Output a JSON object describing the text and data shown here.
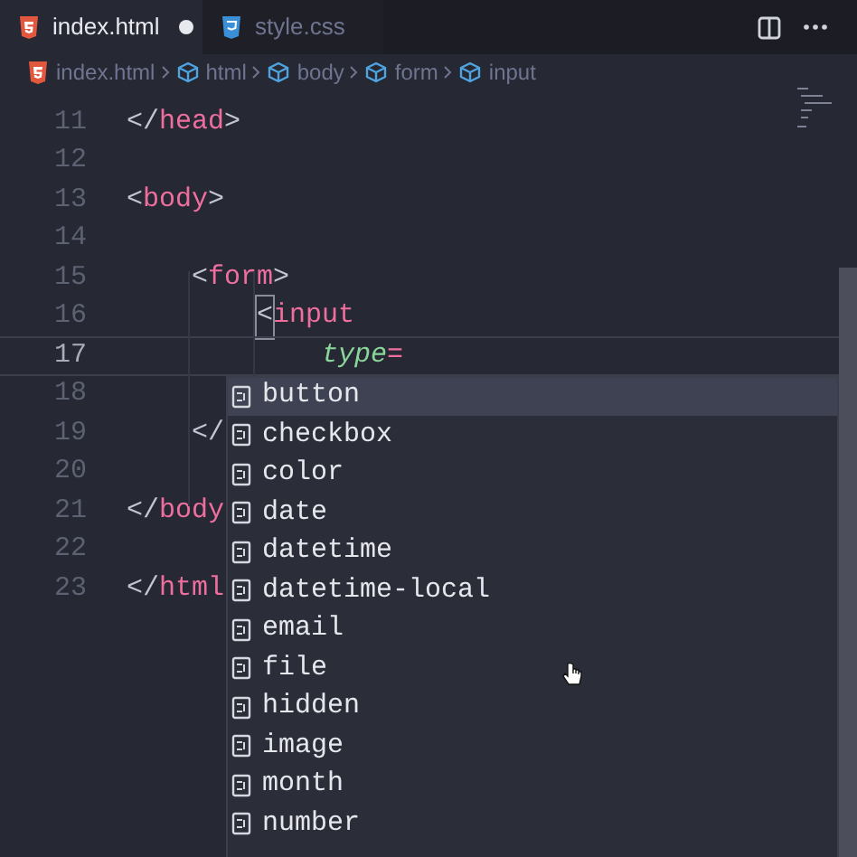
{
  "tabs": [
    {
      "label": "index.html",
      "kind": "html",
      "selected": true,
      "modified": true
    },
    {
      "label": "style.css",
      "kind": "css",
      "selected": false,
      "modified": false
    }
  ],
  "breadcrumb": [
    {
      "label": "index.html",
      "kind": "file"
    },
    {
      "label": "html",
      "kind": "element"
    },
    {
      "label": "body",
      "kind": "element"
    },
    {
      "label": "form",
      "kind": "element"
    },
    {
      "label": "input",
      "kind": "element"
    }
  ],
  "lines": [
    {
      "number": "11",
      "current": false,
      "tokens": [
        {
          "kind": "bracket",
          "text": "</"
        },
        {
          "kind": "tag",
          "text": "head"
        },
        {
          "kind": "bracket",
          "text": ">"
        }
      ]
    },
    {
      "number": "12",
      "current": false
    },
    {
      "number": "13",
      "current": false,
      "tokens": [
        {
          "kind": "bracket",
          "text": "<"
        },
        {
          "kind": "tag",
          "text": "body"
        },
        {
          "kind": "bracket",
          "text": ">"
        }
      ],
      "children": [
        {
          "number": "14",
          "current": false
        },
        {
          "number": "15",
          "current": false,
          "tokens": [
            {
              "kind": "bracket",
              "text": "<"
            },
            {
              "kind": "tag",
              "text": "form"
            },
            {
              "kind": "bracket",
              "text": ">"
            }
          ],
          "children": [
            {
              "number": "16",
              "current": false,
              "tokens": [
                {
                  "kind": "matched",
                  "text": "<"
                },
                {
                  "kind": "tag",
                  "text": "input"
                }
              ],
              "children": [
                {
                  "number": "17",
                  "current": true,
                  "tokens": [
                    {
                      "kind": "attr",
                      "text": "type"
                    },
                    {
                      "kind": "tag",
                      "text": "="
                    }
                  ]
                }
              ]
            },
            {
              "number": "18",
              "current": false
            }
          ]
        },
        {
          "number": "19",
          "current": false,
          "tokens": [
            {
              "kind": "bracket",
              "text": "</"
            }
          ]
        },
        {
          "number": "20",
          "current": false
        }
      ]
    },
    {
      "number": "21",
      "current": false,
      "tokens": [
        {
          "kind": "bracket",
          "text": "</"
        },
        {
          "kind": "tag",
          "text": "body"
        }
      ]
    },
    {
      "number": "22",
      "current": false
    },
    {
      "number": "23",
      "current": false,
      "tokens": [
        {
          "kind": "bracket",
          "text": "</"
        },
        {
          "kind": "tag",
          "text": "html"
        }
      ]
    }
  ],
  "suggestions": [
    {
      "label": "button",
      "selected": true
    },
    {
      "label": "checkbox",
      "selected": false
    },
    {
      "label": "color",
      "selected": false
    },
    {
      "label": "date",
      "selected": false
    },
    {
      "label": "datetime",
      "selected": false
    },
    {
      "label": "datetime-local",
      "selected": false
    },
    {
      "label": "email",
      "selected": false
    },
    {
      "label": "file",
      "selected": false
    },
    {
      "label": "hidden",
      "selected": false
    },
    {
      "label": "image",
      "selected": false
    },
    {
      "label": "month",
      "selected": false
    },
    {
      "label": "number",
      "selected": false
    }
  ]
}
